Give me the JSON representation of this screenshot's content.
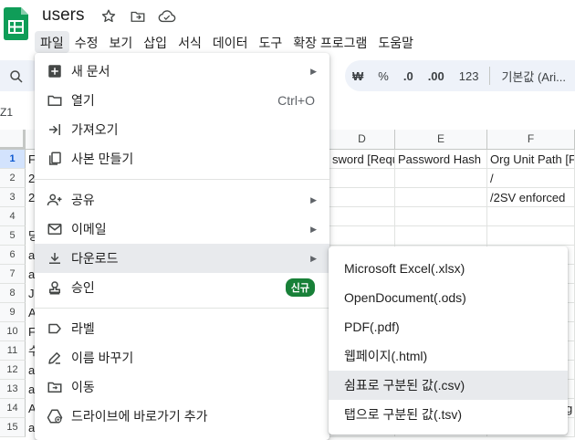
{
  "doc": {
    "title": "users"
  },
  "menubar": {
    "items": [
      "파일",
      "수정",
      "보기",
      "삽입",
      "서식",
      "데이터",
      "도구",
      "확장 프로그램",
      "도움말"
    ]
  },
  "toolbar": {
    "currency": "₩",
    "percent": "%",
    "dec_decrease": ".0",
    "dec_increase": ".00",
    "number_format": "123",
    "font": "기본값 (Ari..."
  },
  "namebox": {
    "value": "Z1"
  },
  "grid": {
    "columns": [
      "D",
      "E",
      "F"
    ],
    "rows": [
      "1",
      "2",
      "3",
      "4",
      "5",
      "6",
      "7",
      "8",
      "9",
      "10",
      "11",
      "12",
      "13",
      "14",
      "15"
    ],
    "col_a_fragments": [
      "F",
      "2",
      "2",
      "",
      "당",
      "a",
      "a",
      "J",
      "A",
      "F",
      "수",
      "a",
      "a",
      "A",
      "a"
    ],
    "row1": {
      "c": "sword [Requi",
      "e": "Password Hash",
      "f": "Org Unit Path [F"
    },
    "row2": {
      "f": "/"
    },
    "row3": {
      "f": "/2SV enforced"
    },
    "row14": {
      "g": "g"
    }
  },
  "file_menu": {
    "items": [
      {
        "label": "새 문서",
        "icon": "new-doc-icon",
        "submenu": true
      },
      {
        "label": "열기",
        "icon": "folder-icon",
        "shortcut": "Ctrl+O"
      },
      {
        "label": "가져오기",
        "icon": "import-icon"
      },
      {
        "label": "사본 만들기",
        "icon": "copy-icon"
      },
      {
        "label": "공유",
        "icon": "add-person-icon",
        "submenu": true
      },
      {
        "label": "이메일",
        "icon": "mail-icon",
        "submenu": true
      },
      {
        "label": "다운로드",
        "icon": "download-icon",
        "submenu": true
      },
      {
        "label": "승인",
        "icon": "approval-icon",
        "badge": "신규"
      },
      {
        "label": "라벨",
        "icon": "label-icon"
      },
      {
        "label": "이름 바꾸기",
        "icon": "rename-icon"
      },
      {
        "label": "이동",
        "icon": "move-icon"
      },
      {
        "label": "드라이브에 바로가기 추가",
        "icon": "drive-shortcut-icon"
      }
    ]
  },
  "download_menu": {
    "items": [
      "Microsoft Excel(.xlsx)",
      "OpenDocument(.ods)",
      "PDF(.pdf)",
      "웹페이지(.html)",
      "쉼표로 구분된 값(.csv)",
      "탭으로 구분된 값(.tsv)"
    ],
    "highlighted_index": 4
  },
  "colors": {
    "sheets_green": "#0f9d58",
    "badge_green": "#188038",
    "hover_gray": "#e8eaed",
    "selected_row": "#d3e3fd"
  }
}
